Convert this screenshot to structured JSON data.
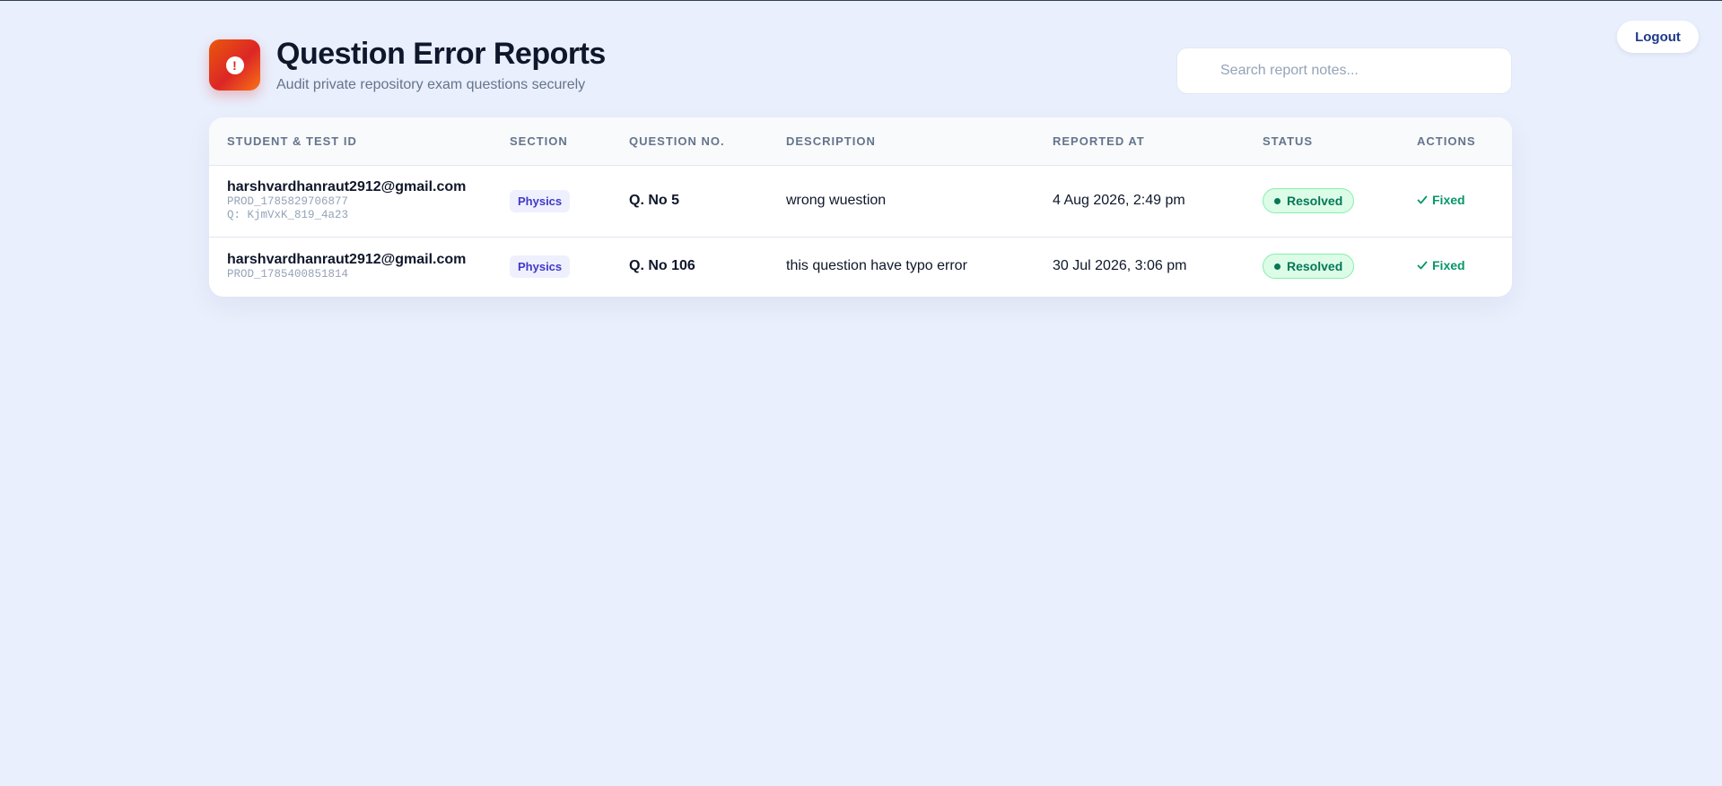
{
  "header": {
    "title": "Question Error Reports",
    "subtitle": "Audit private repository exam questions securely",
    "icon": "alert-circle-icon"
  },
  "topbar": {
    "logout_label": "Logout"
  },
  "search": {
    "placeholder": "Search report notes...",
    "value": ""
  },
  "table": {
    "columns": [
      "Student & Test ID",
      "Section",
      "Question No.",
      "Description",
      "Reported At",
      "Status",
      "Actions"
    ],
    "rows": [
      {
        "email": "harshvardhanraut2912@gmail.com",
        "test_id": "PROD_1785829706877",
        "question_id": "Q: KjmVxK_819_4a23",
        "section": "Physics",
        "question_no": "Q. No 5",
        "description": "wrong wuestion",
        "reported_at": "4 Aug 2026, 2:49 pm",
        "status": "Resolved",
        "action": "Fixed"
      },
      {
        "email": "harshvardhanraut2912@gmail.com",
        "test_id": "PROD_1785400851814",
        "section": "Physics",
        "question_no": "Q. No 106",
        "description": "this question have typo error",
        "reported_at": "30 Jul 2026, 3:06 pm",
        "status": "Resolved",
        "action": "Fixed"
      }
    ]
  },
  "colors": {
    "background": "#e9effd",
    "accent_orange": "#ea580c",
    "accent_red": "#dc2626",
    "status_green": "#047857",
    "section_badge": "#4338ca"
  }
}
